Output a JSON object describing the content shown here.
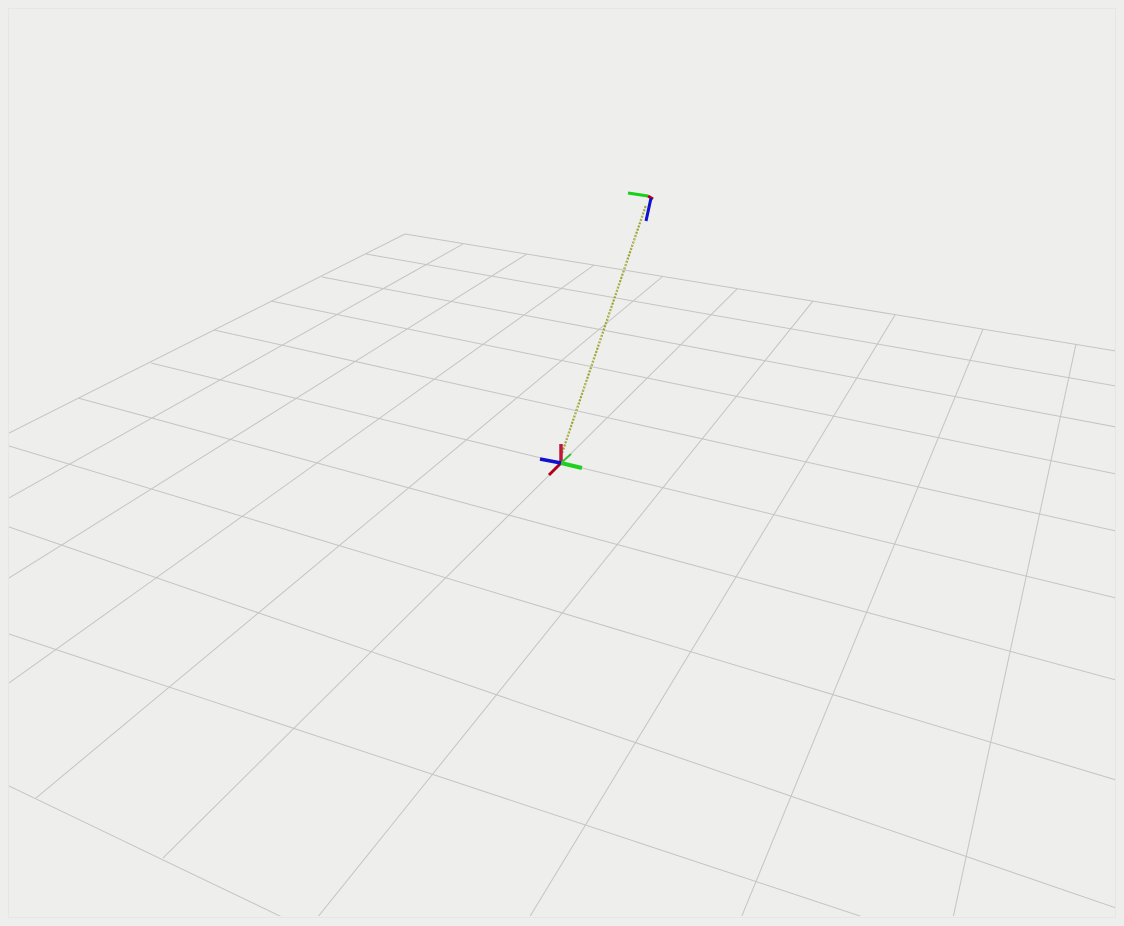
{
  "scene": {
    "background_color": "#eeeeed",
    "grid_color": "#c4c4c4",
    "axis_colors": {
      "x": "#c00020",
      "y": "#18d018",
      "z": "#1010d0"
    },
    "link_color": "#a8b040"
  }
}
